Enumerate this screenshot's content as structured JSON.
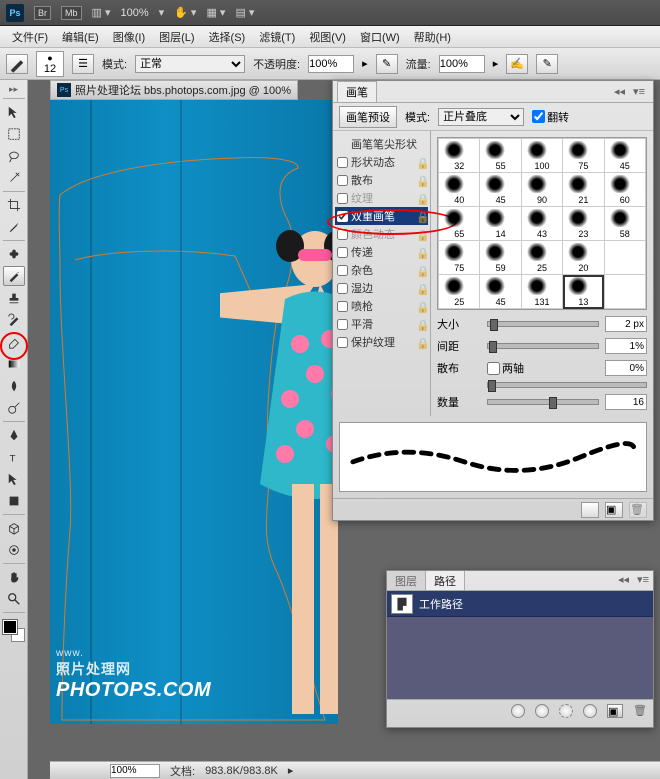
{
  "topbar": {
    "zoom": "100%"
  },
  "menu": {
    "file": "文件(F)",
    "edit": "编辑(E)",
    "image": "图像(I)",
    "layer": "图层(L)",
    "select": "选择(S)",
    "filter": "滤镜(T)",
    "view": "视图(V)",
    "window": "窗口(W)",
    "help": "帮助(H)"
  },
  "options": {
    "brush_size": "12",
    "mode_label": "模式:",
    "mode_value": "正常",
    "opacity_label": "不透明度:",
    "opacity_value": "100%",
    "flow_label": "流量:",
    "flow_value": "100%"
  },
  "document": {
    "tab_title": "照片处理论坛 bbs.photops.com.jpg @ 100%",
    "status_zoom": "100%",
    "status_label": "文档:",
    "status_value": "983.8K/983.8K"
  },
  "watermark": {
    "line1": "www.",
    "line2": "照片处理网",
    "line3": "PHOTOPS.COM"
  },
  "brush_panel": {
    "tab": "画笔",
    "preset_btn": "画笔预设",
    "mode_label": "模式:",
    "mode_value": "正片叠底",
    "flip_label": "翻转",
    "settings": {
      "tip_shape": "画笔笔尖形状",
      "shape_dynamics": "形状动态",
      "scattering": "散布",
      "texture": "纹理",
      "dual_brush": "双重画笔",
      "color_dynamics": "颜色动态",
      "transfer": "传递",
      "noise": "杂色",
      "wet_edges": "湿边",
      "airbrush": "喷枪",
      "smoothing": "平滑",
      "protect_texture": "保护纹理"
    },
    "thumbs": [
      [
        "32",
        "55",
        "100",
        "75",
        "45"
      ],
      [
        "40",
        "45",
        "90",
        "21",
        "60"
      ],
      [
        "65",
        "14",
        "43",
        "23",
        "58"
      ],
      [
        "75",
        "59",
        "25",
        "20",
        ""
      ],
      [
        "25",
        "45",
        "131",
        "13",
        ""
      ]
    ],
    "thumb_selected": [
      4,
      3
    ],
    "size_label": "大小",
    "size_value": "2 px",
    "spacing_label": "间距",
    "spacing_value": "1%",
    "scatter_label": "散布",
    "both_axes": "两轴",
    "scatter_value": "0%",
    "count_label": "数量",
    "count_value": "16"
  },
  "paths_panel": {
    "tab_layers": "图层",
    "tab_paths": "路径",
    "item": "工作路径"
  },
  "chart_data": null
}
